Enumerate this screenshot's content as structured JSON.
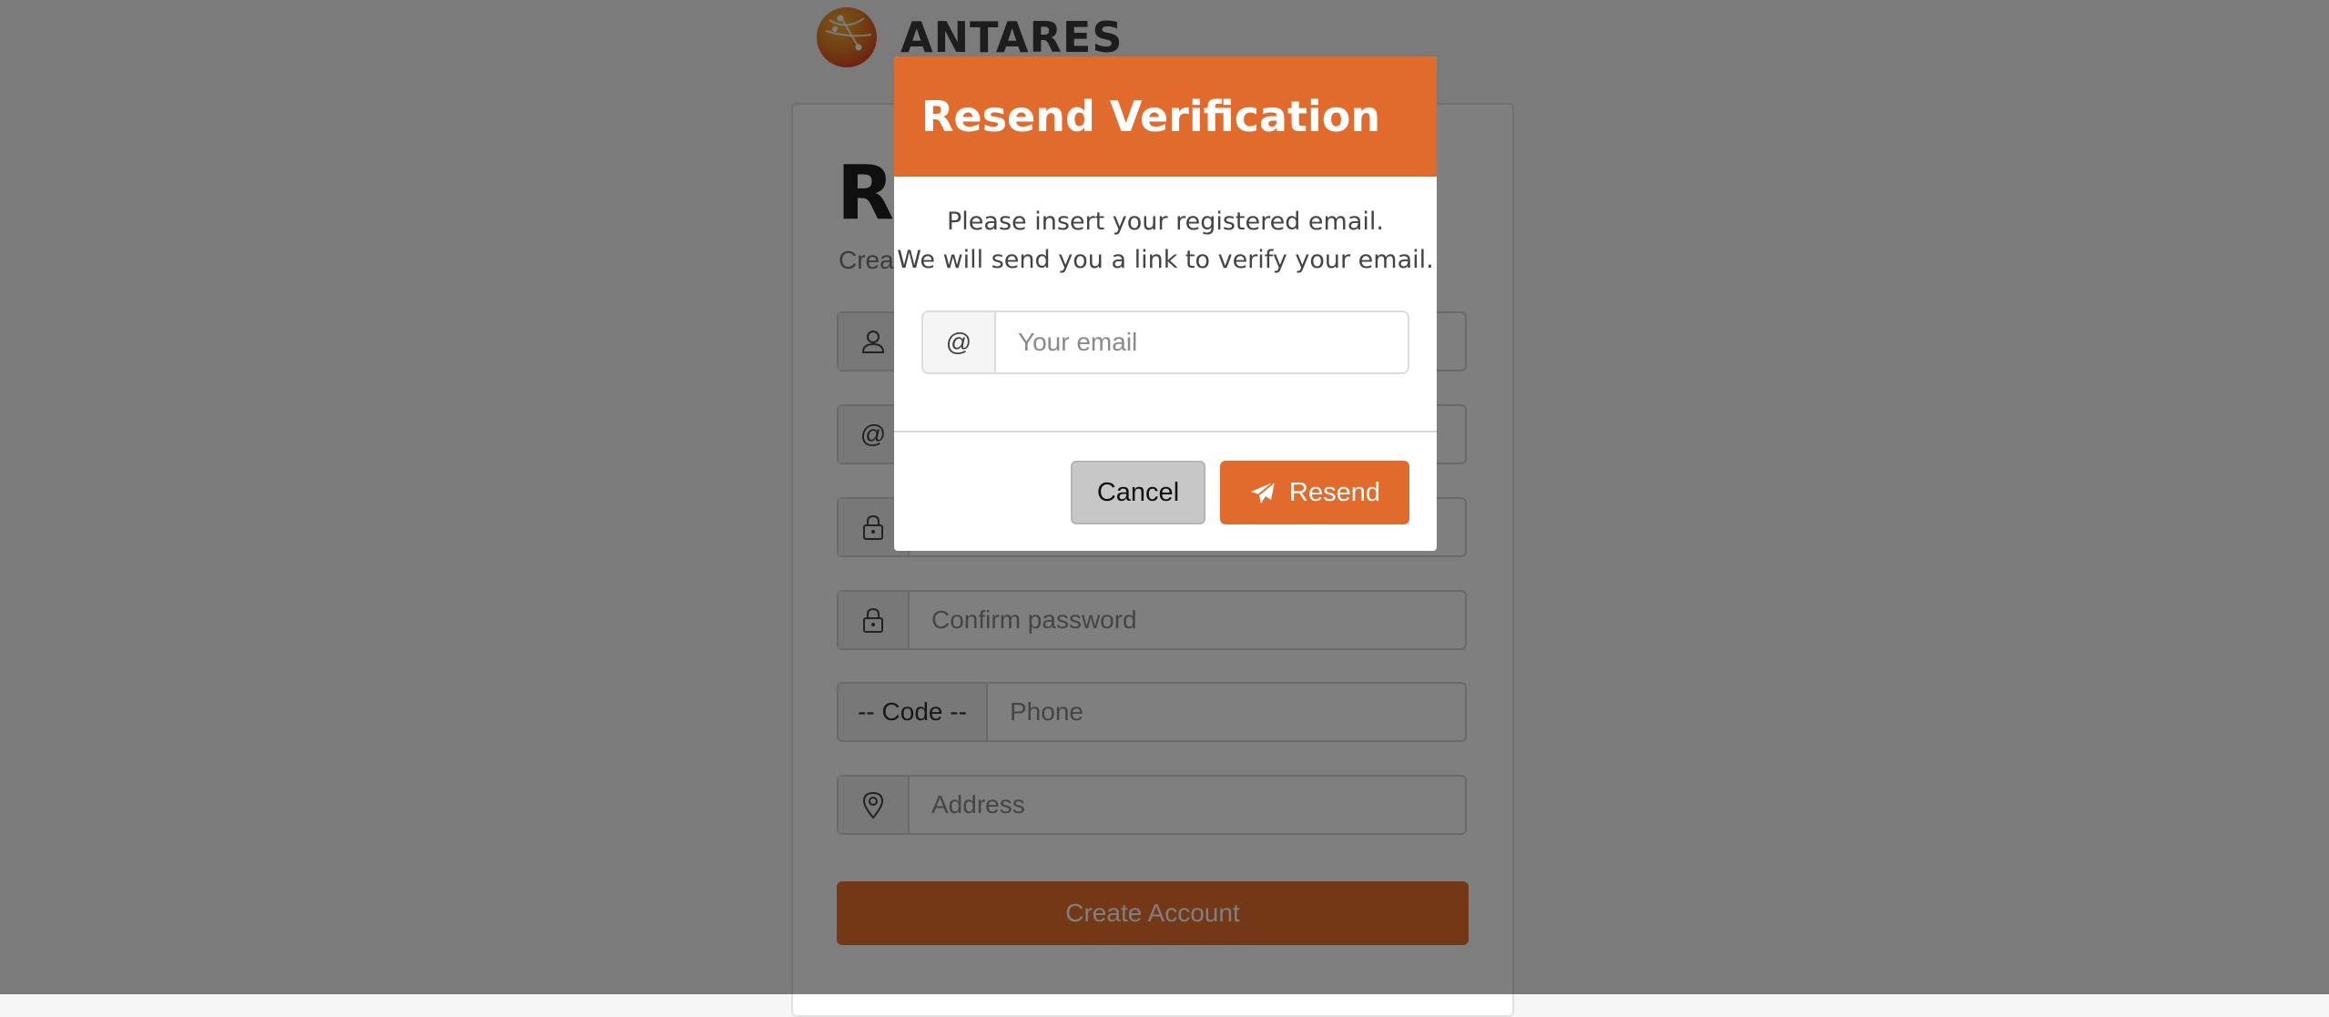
{
  "brand": {
    "name": "ANTARES",
    "logo_icon": "antares-globe-logo"
  },
  "register_form": {
    "title": "Re",
    "subtitle": "Creat",
    "fields": [
      {
        "icon": "user-icon"
      },
      {
        "icon": "at-icon",
        "symbol": "@"
      },
      {
        "icon": "lock-icon"
      },
      {
        "icon": "lock-icon",
        "placeholder": "Confirm password"
      },
      {
        "icon": "location-pin-icon",
        "placeholder": "Address"
      }
    ],
    "phone_code_label": "-- Code --",
    "phone_placeholder": "Phone",
    "create_button_label": "Create Account"
  },
  "modal": {
    "title": "Resend Verification",
    "message_line1": "Please insert your registered email.",
    "message_line2": "We will send you a link to verify your email.",
    "email_addon": "@",
    "email_placeholder": "Your email",
    "email_value": "",
    "cancel_label": "Cancel",
    "resend_label": "Resend",
    "resend_icon": "paper-plane-icon"
  },
  "colors": {
    "accent": "#e06b2d",
    "overlay": "rgba(0,0,0,0.5)",
    "cancel_bg": "#c7c7c7"
  }
}
